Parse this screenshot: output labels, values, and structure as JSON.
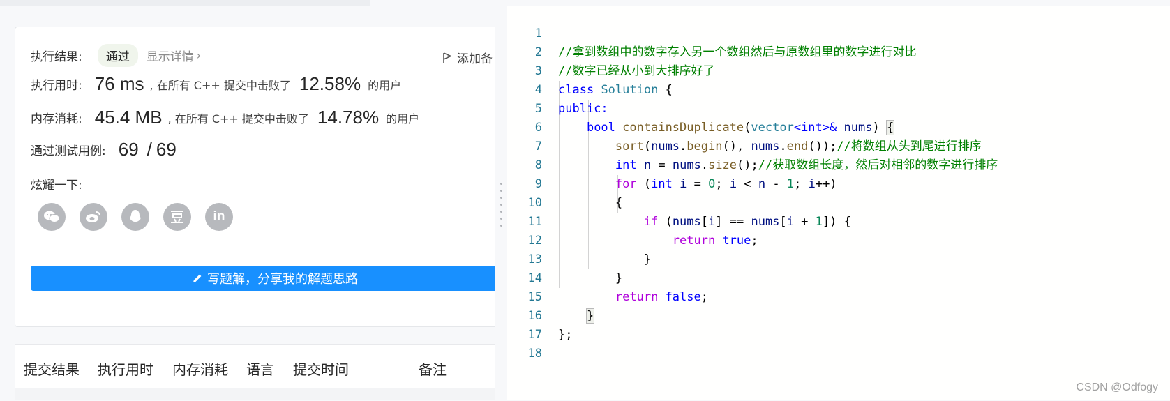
{
  "result": {
    "label": "执行结果:",
    "status": "通过",
    "details_link": "显示详情",
    "add_note": "添加备"
  },
  "runtime": {
    "label": "执行用时:",
    "value": "76 ms",
    "mid_text": ", 在所有 C++ 提交中击败了",
    "percent": "12.58%",
    "suffix": "的用户"
  },
  "memory": {
    "label": "内存消耗:",
    "value": "45.4 MB",
    "mid_text": ", 在所有 C++ 提交中击败了",
    "percent": "14.78%",
    "suffix": "的用户"
  },
  "tests": {
    "label": "通过测试用例:",
    "passed": "69",
    "sep": "/",
    "total": "69"
  },
  "share": {
    "label": "炫耀一下:",
    "icons": [
      "wechat-icon",
      "weibo-icon",
      "qq-icon",
      "douban-icon",
      "linkedin-icon"
    ]
  },
  "write_button": "写题解，分享我的解题思路",
  "tabs": [
    "提交结果",
    "执行用时",
    "内存消耗",
    "语言",
    "提交时间",
    "备注"
  ],
  "editor": {
    "line_numbers": [
      "1",
      "2",
      "3",
      "4",
      "5",
      "6",
      "7",
      "8",
      "9",
      "10",
      "11",
      "12",
      "13",
      "14",
      "15",
      "16",
      "17",
      "18"
    ],
    "comments": {
      "l1": "//拿到数组中的数字存入另一个数组然后与原数组里的数字进行对比",
      "l2": "//数字已经从小到大排序好了",
      "l6": "//将数组从头到尾进行排序",
      "l7": "//获取数组长度，然后对相邻的数字进行排序"
    }
  },
  "watermark": "CSDN @Odfogy"
}
